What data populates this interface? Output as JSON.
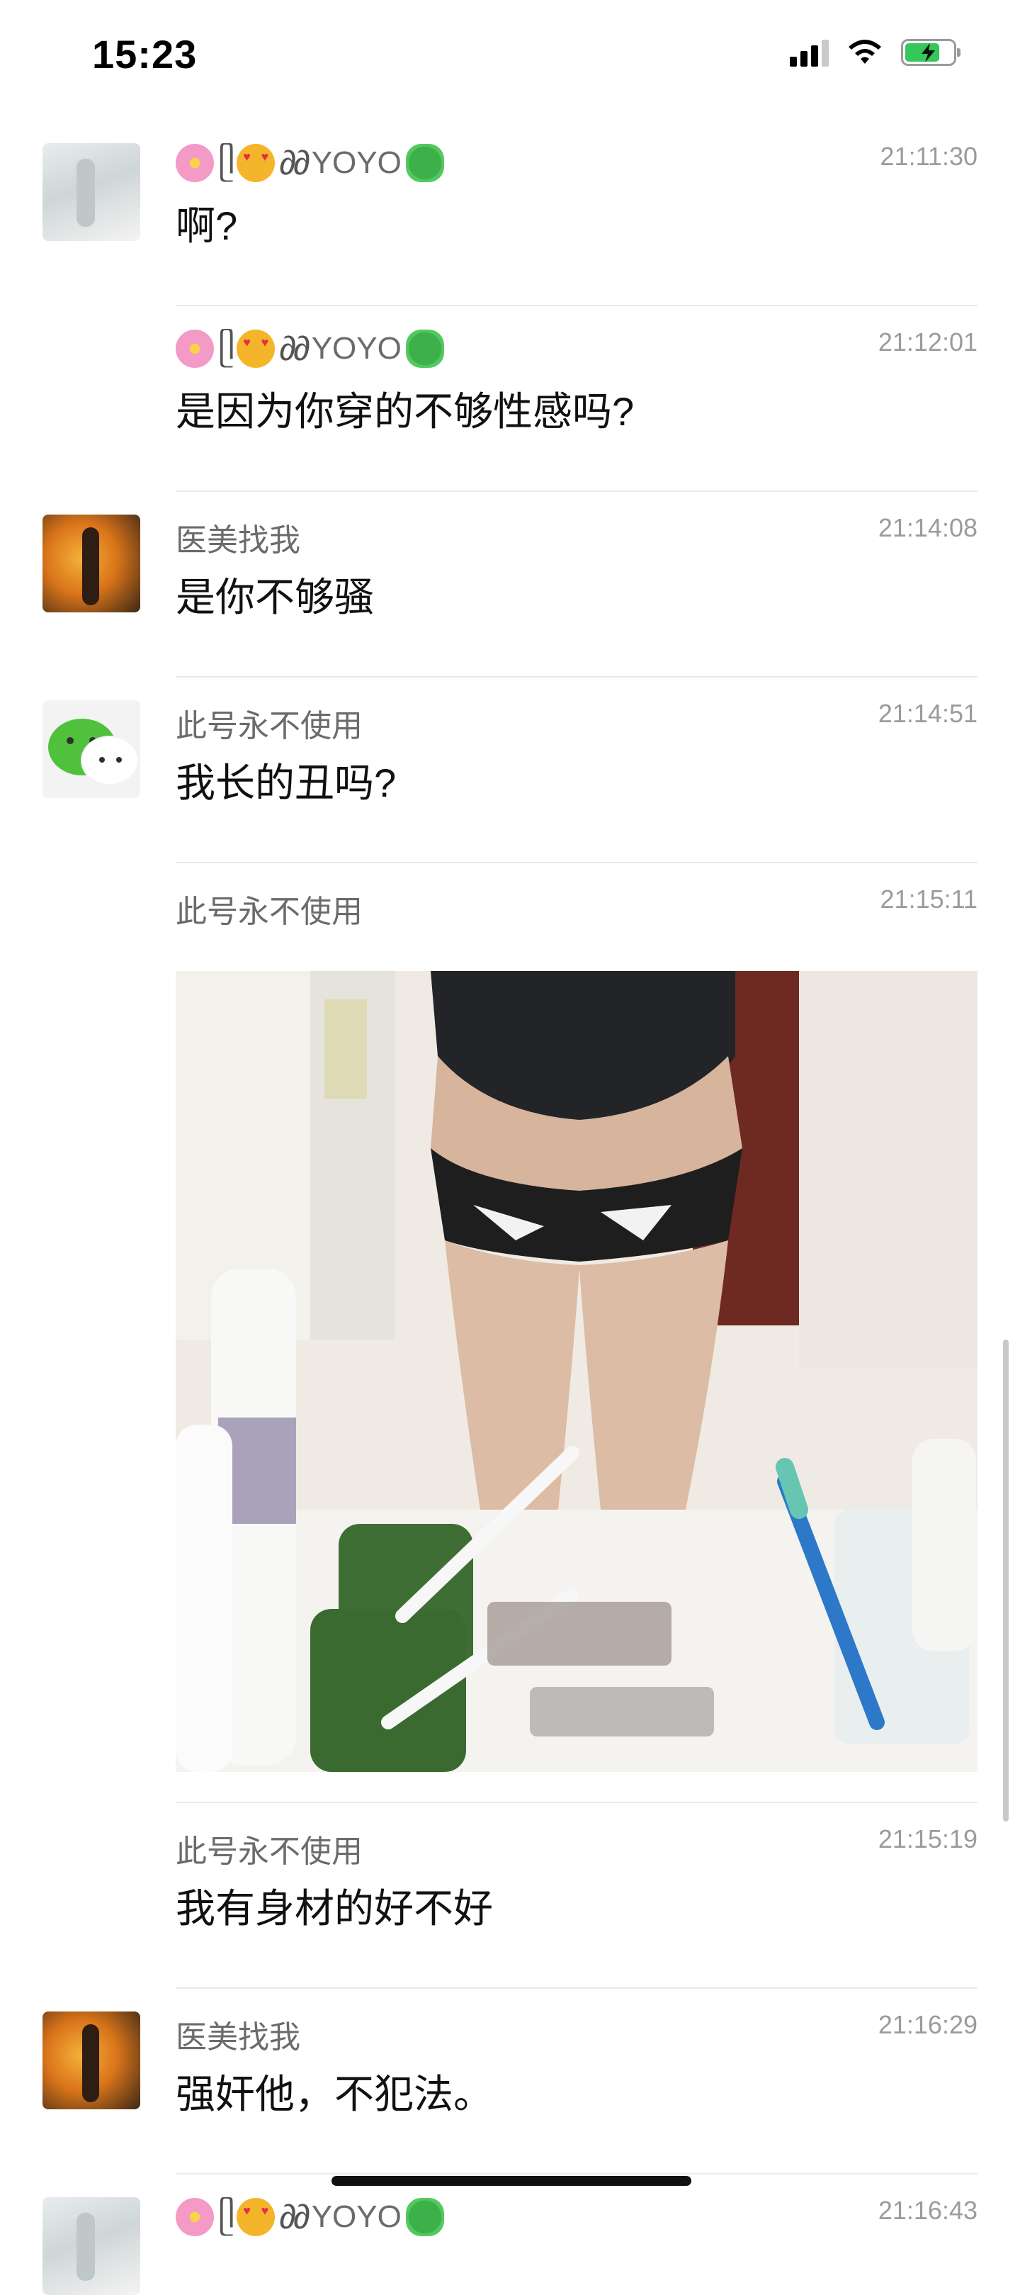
{
  "status_bar": {
    "time": "15:23",
    "battery_level": 0.75,
    "battery_state": "charging"
  },
  "messages": [
    {
      "sender": "YOYO",
      "time": "21:11:30",
      "text": "啊?",
      "avatar": "avatar-yoyo"
    },
    {
      "sender": "YOYO",
      "time": "21:12:01",
      "text": "是因为你穿的不够性感吗?"
    },
    {
      "sender": "医美找我",
      "time": "21:14:08",
      "text": "是你不够骚",
      "avatar": "avatar-yimei"
    },
    {
      "sender": "此号永不使用",
      "time": "21:14:51",
      "text": "我长的丑吗?",
      "avatar": "wechat-logo-avatar"
    },
    {
      "sender": "此号永不使用",
      "time": "21:15:11",
      "image": "mirror-selfie-bathroom-photo"
    },
    {
      "sender": "此号永不使用",
      "time": "21:15:19",
      "text": "我有身材的好不好"
    },
    {
      "sender": "医美找我",
      "time": "21:16:29",
      "text": "强奸他，不犯法。",
      "avatar": "avatar-yimei"
    },
    {
      "sender": "YOYO",
      "time": "21:16:43",
      "avatar": "avatar-yoyo"
    }
  ],
  "icons": {
    "signal": "cellular-signal-icon",
    "wifi": "wifi-icon",
    "battery": "battery-charging-icon",
    "yoyo_name_decor": [
      "cherry-blossom-emoji",
      "heart-eyes-emoji",
      "clover-emoji"
    ]
  },
  "colors": {
    "sender_name": "#6b6b6b",
    "timestamp": "#9b9b9b",
    "wechat_green": "#4fc13c",
    "battery_green": "#34c759"
  }
}
